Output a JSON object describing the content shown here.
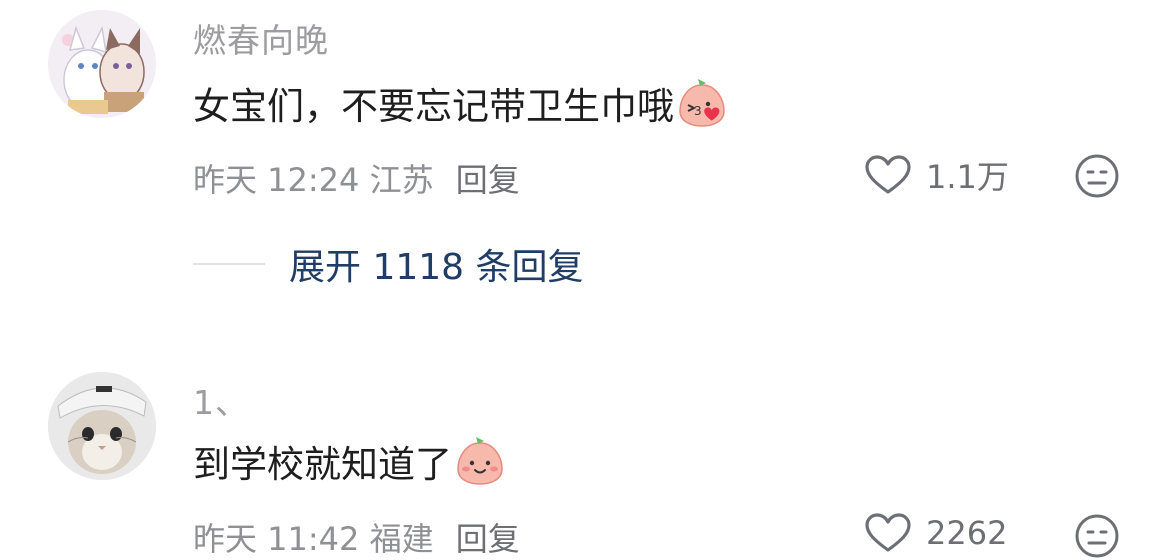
{
  "comments": [
    {
      "username": "燃春向晚",
      "text": "女宝们，不要忘记带卫生巾哦",
      "emoji": "kiss-face-emoji",
      "time": "昨天 12:24",
      "location": "江苏",
      "reply_label": "回复",
      "likes": "1.1万",
      "expand_label": "展开 1118 条回复"
    },
    {
      "username": "1、",
      "text": "到学校就知道了",
      "emoji": "smile-face-emoji",
      "time": "昨天 11:42",
      "location": "福建",
      "reply_label": "回复",
      "likes": "2262"
    }
  ],
  "colors": {
    "link": "#1f3d66",
    "meta": "#8f9095",
    "username": "#9c9ca1"
  }
}
